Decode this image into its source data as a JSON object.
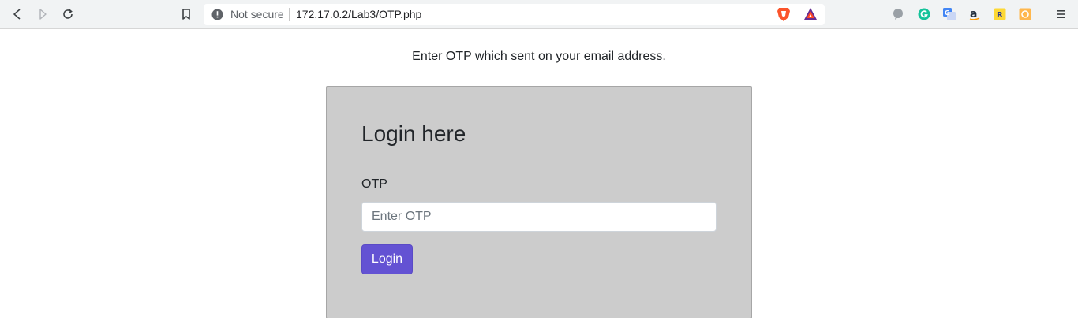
{
  "browser": {
    "security_label": "Not secure",
    "url": "172.17.0.2/Lab3/OTP.php",
    "icons": [
      "back-icon",
      "forward-icon",
      "reload-icon",
      "bookmark-icon",
      "info-icon",
      "brave-shields-icon",
      "brave-rewards-icon",
      "extension-icon",
      "grammarly-icon",
      "google-translate-icon",
      "amazon-icon",
      "extension-r-icon",
      "extension-orange-icon",
      "menu-icon"
    ]
  },
  "page": {
    "instruction": "Enter OTP which sent on your email address.",
    "card": {
      "title": "Login here",
      "otp_label": "OTP",
      "otp_placeholder": "Enter OTP",
      "otp_value": "",
      "login_label": "Login"
    }
  },
  "colors": {
    "card_background": "#cccccc",
    "button": "#6352d3",
    "page_background": "#ffffff"
  }
}
